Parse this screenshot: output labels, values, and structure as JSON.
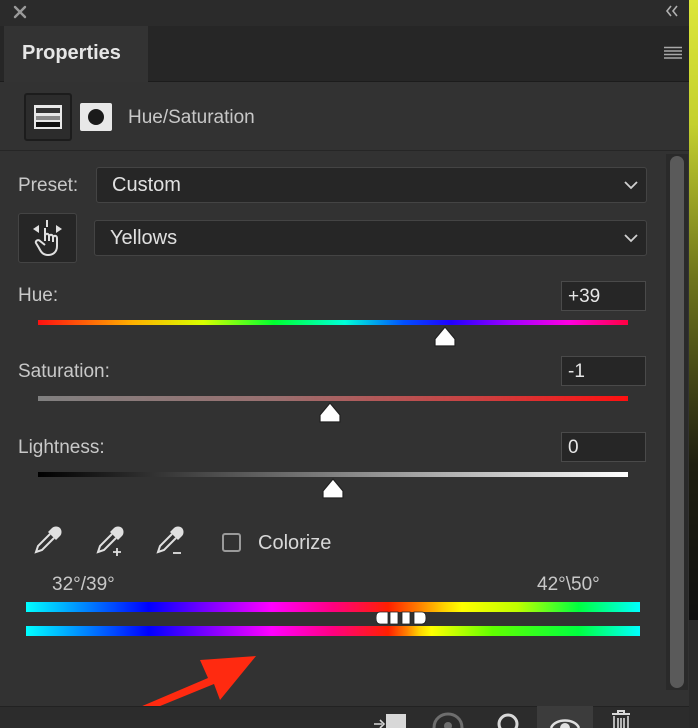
{
  "panel": {
    "tab_label": "Properties",
    "adjustment_title": "Hue/Saturation"
  },
  "preset": {
    "label": "Preset:",
    "value": "Custom"
  },
  "channel": {
    "value": "Yellows"
  },
  "hue": {
    "label": "Hue:",
    "value": "+39",
    "slider_fraction": 0.69
  },
  "saturation": {
    "label": "Saturation:",
    "value": "-1",
    "slider_fraction": 0.495
  },
  "lightness": {
    "label": "Lightness:",
    "value": "0",
    "slider_fraction": 0.5
  },
  "colorize": {
    "label": "Colorize",
    "checked": false
  },
  "range": {
    "left": "32°/39°",
    "right": "42°\\50°"
  },
  "colors": {
    "arrow": "#ff2a10",
    "panel_bg": "#323232",
    "field_bg": "#262626"
  },
  "icons": {
    "close": "close-icon",
    "collapse": "double-chevron-icon",
    "menu": "hamburger-menu-icon",
    "adjustment": "hue-saturation-layer-icon",
    "mask": "layer-mask-icon",
    "target": "targeted-adjustment-hand-icon",
    "eyedropper": "eyedropper-icon",
    "eyedropper_add": "eyedropper-add-icon",
    "eyedropper_subtract": "eyedropper-subtract-icon"
  }
}
